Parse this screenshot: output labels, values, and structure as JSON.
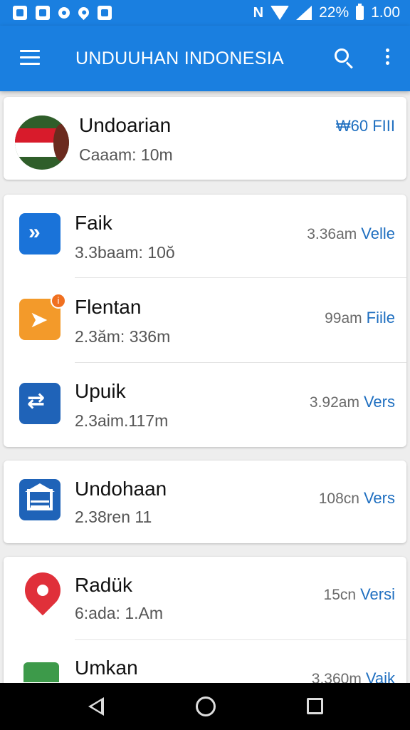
{
  "status_bar": {
    "battery_percent": "22%",
    "time": "1.00",
    "icons": [
      "notification-icon",
      "photo-icon",
      "circle-icon",
      "location-icon",
      "image-icon",
      "nfc-icon",
      "wifi-icon",
      "signal-icon",
      "battery-icon"
    ]
  },
  "app_bar": {
    "title": "UNDUUHAN INDONESIA",
    "icons": [
      "menu-icon",
      "search-icon",
      "more-vert-icon"
    ]
  },
  "featured": {
    "name": "Undoarian",
    "subtitle": "Caaam: 10m",
    "meta": "₩60 FIII",
    "icon": "indonesia-flag-icon"
  },
  "group1": [
    {
      "name": "Faik",
      "subtitle": "3.3baam: 10ŏ",
      "size": "3.36am",
      "action": "Velle",
      "icon": "arrow-forward-icon",
      "color": "#1a73d9"
    },
    {
      "name": "Flentan",
      "subtitle": "2.3ăm: 336m",
      "size": "99am",
      "action": "Fiile",
      "icon": "send-icon",
      "color": "#f39a2a"
    },
    {
      "name": "Upuik",
      "subtitle": "2.3aim.117m",
      "size": "3.92am",
      "action": "Vers",
      "icon": "update-icon",
      "color": "#1f63b8"
    }
  ],
  "single": {
    "name": "Undohaan",
    "subtitle": "2.38ren 11",
    "size": "108cn",
    "action": "Vers",
    "icon": "home-icon",
    "color": "#1f63b8"
  },
  "group2": [
    {
      "name": "Radük",
      "subtitle": "6:ada: 1.Am",
      "size": "15cn",
      "action": "Versi",
      "icon": "map-pin-icon",
      "color": "#e0303a"
    },
    {
      "name": "Umkan",
      "subtitle": "",
      "size": "3.360m",
      "action": "Vaik",
      "icon": "store-icon",
      "color": "#3d9a4a"
    }
  ],
  "nav_bar": {
    "icons": [
      "back-icon",
      "home-circle-icon",
      "recents-icon"
    ]
  }
}
